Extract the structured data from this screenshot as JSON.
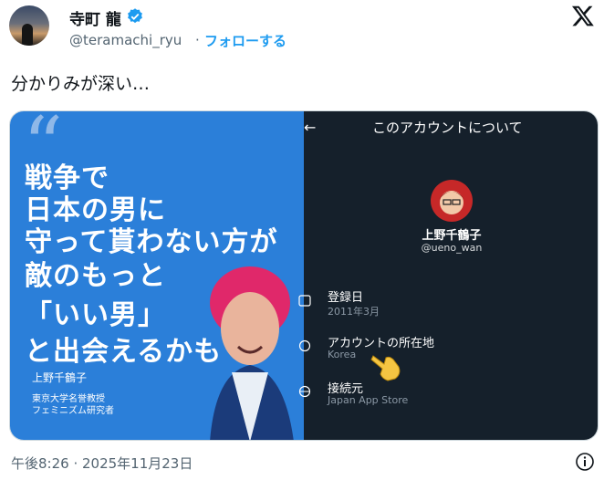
{
  "author": {
    "name": "寺町 龍",
    "handle": "@teramachi_ryu",
    "separator": "·",
    "follow_label": "フォローする"
  },
  "tweet": {
    "text": "分かりみが深い…",
    "timestamp": "午後8:26 · 2025年11月23日"
  },
  "left_image": {
    "lines": [
      "戦争で",
      "日本の男に",
      "守って貰わない方が",
      "敵のもっと",
      "「いい男」",
      "と出会えるかも"
    ],
    "name": "上野千鶴子",
    "caption1": "東京大学名誉教授",
    "caption2": "フェミニズム研究者"
  },
  "right_image": {
    "header": "このアカウントについて",
    "display_name": "上野千鶴子",
    "handle": "@ueno_wan",
    "rows": [
      {
        "label": "登録日",
        "value": "2011年3月"
      },
      {
        "label": "アカウントの所在地",
        "value": "Korea"
      },
      {
        "label": "接続元",
        "value": "Japan App Store"
      }
    ]
  },
  "colors": {
    "link": "#1d9bf0",
    "verified": "#1d9bf0",
    "left_bg": "#2b7fd9",
    "right_bg": "#15202b"
  }
}
